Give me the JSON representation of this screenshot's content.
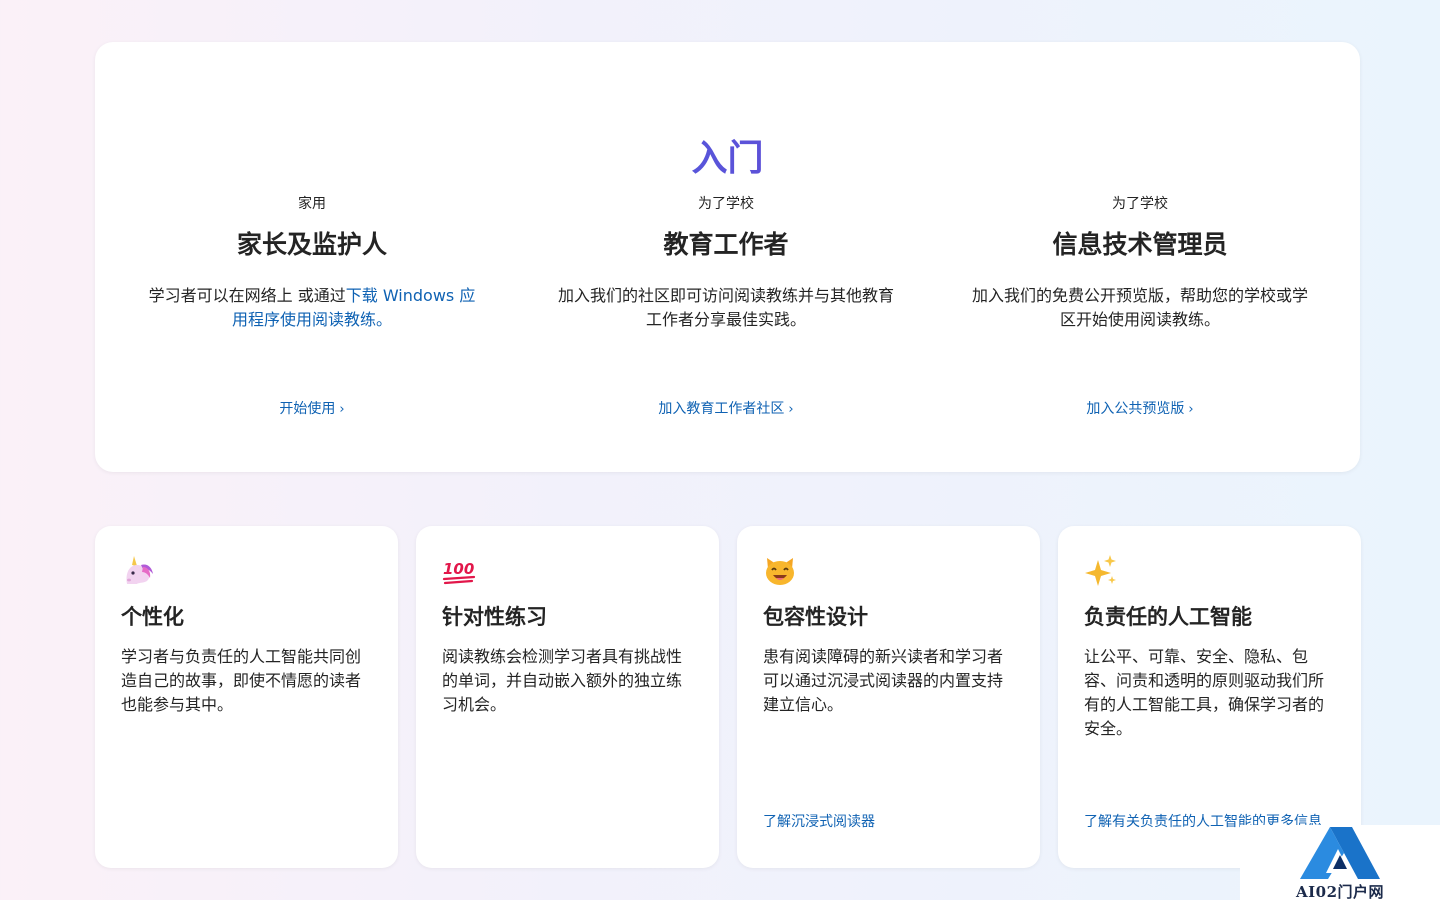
{
  "section": {
    "title": "入门",
    "columns": [
      {
        "eyebrow": "家用",
        "heading": "家长及监护人",
        "body_text": "学习者可以在网络上 或通过",
        "body_link": "下载 Windows 应用程序使用阅读教练。",
        "cta": "开始使用"
      },
      {
        "eyebrow": "为了学校",
        "heading": "教育工作者",
        "body_text": "加入我们的社区即可访问阅读教练并与其他教育工作者分享最佳实践。",
        "cta": "加入教育工作者社区"
      },
      {
        "eyebrow": "为了学校",
        "heading": "信息技术管理员",
        "body_text": "加入我们的免费公开预览版，帮助您的学校或学区开始使用阅读教练。",
        "cta": "加入公共预览版"
      }
    ]
  },
  "features": [
    {
      "icon": "unicorn-icon",
      "title": "个性化",
      "text": "学习者与负责任的人工智能共同创造自己的故事，即使不情愿的读者也能参与其中。",
      "link": ""
    },
    {
      "icon": "hundred-points-icon",
      "title": "针对性练习",
      "text": "阅读教练会检测学习者具有挑战性的单词，并自动嵌入额外的独立练习机会。",
      "link": ""
    },
    {
      "icon": "grinning-cat-icon",
      "title": "包容性设计",
      "text": "患有阅读障碍的新兴读者和学习者可以通过沉浸式阅读器的内置支持建立信心。",
      "link": "了解沉浸式阅读器"
    },
    {
      "icon": "sparkles-icon",
      "title": "负责任的人工智能",
      "text": "让公平、可靠、安全、隐私、包容、问责和透明的原则驱动我们所有的人工智能工具，确保学习者的安全。",
      "link": "了解有关负责任的人工智能的更多信息"
    }
  ],
  "watermark": {
    "text": "AI02门户网"
  },
  "colors": {
    "link": "#0f62b3",
    "title_gradient_start": "#2f7be5",
    "title_gradient_end": "#8a2ec9"
  }
}
